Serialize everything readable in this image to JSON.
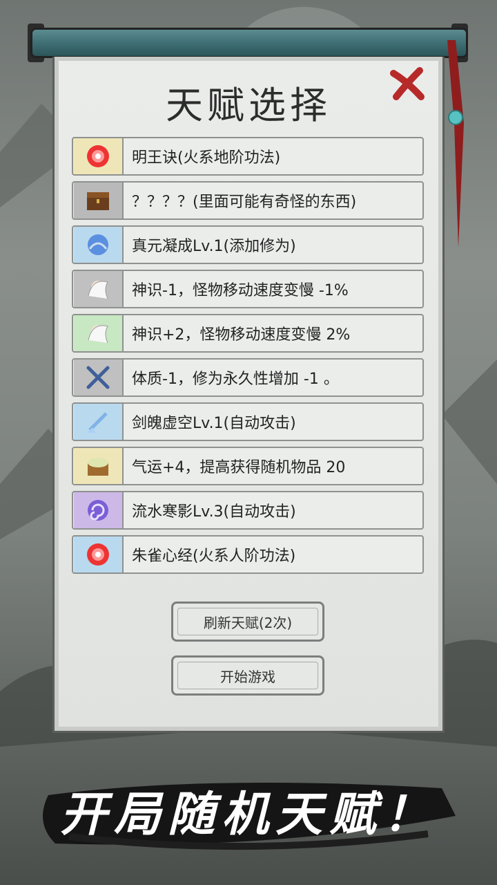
{
  "dialog": {
    "title": "天赋选择",
    "close_icon": "close-x-icon"
  },
  "talents": [
    {
      "label": "明王诀(火系地阶功法)",
      "icon": "red-orb-icon",
      "tint": "#efe6b8"
    },
    {
      "label": "？？？？(里面可能有奇怪的东西)",
      "icon": "chest-icon",
      "tint": "#b9b9b9"
    },
    {
      "label": "真元凝成Lv.1(添加修为)",
      "icon": "blue-orb-icon",
      "tint": "#b9d9ee"
    },
    {
      "label": "神识-1，怪物移动速度变慢 -1%",
      "icon": "white-hair-avatar-icon",
      "tint": "#c0c0c0"
    },
    {
      "label": "神识+2，怪物移动速度变慢 2%",
      "icon": "white-hair-avatar-icon",
      "tint": "#c8e7c3"
    },
    {
      "label": "体质-1，修为永久性增加 -1 。",
      "icon": "crossed-swords-icon",
      "tint": "#c0c0c0"
    },
    {
      "label": "剑魄虚空Lv.1(自动攻击)",
      "icon": "ice-sword-icon",
      "tint": "#b9d9ee"
    },
    {
      "label": "气运+4，提高获得随机物品 20",
      "icon": "treasure-chest-icon",
      "tint": "#efe6b8"
    },
    {
      "label": "流水寒影Lv.3(自动攻击)",
      "icon": "purple-vortex-icon",
      "tint": "#cdb9e8"
    },
    {
      "label": "朱雀心经(火系人阶功法)",
      "icon": "red-orb-icon",
      "tint": "#b9d9ee"
    }
  ],
  "buttons": {
    "refresh": "刷新天赋(2次)",
    "start": "开始游戏"
  },
  "slogan": "开局随机天赋！"
}
